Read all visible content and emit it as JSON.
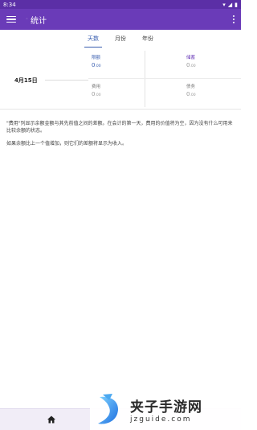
{
  "statusbar": {
    "time": "8:34",
    "battery": "▮",
    "wifi": "▾",
    "signal": "◢"
  },
  "appbar": {
    "title": "统计",
    "title_prefix": "◦"
  },
  "tabs": [
    {
      "label": "天数",
      "active": true
    },
    {
      "label": "月份",
      "active": false
    },
    {
      "label": "年份",
      "active": false
    }
  ],
  "stats": {
    "date": "4月15日",
    "balance": {
      "label": "限额",
      "value": "0",
      "decimals": ".00"
    },
    "savings": {
      "label": "储蓄",
      "value": "0",
      "decimals": ".00"
    },
    "expense": {
      "label": "费用",
      "value": "0",
      "decimals": ".00"
    },
    "debt": {
      "label": "债务",
      "value": "0",
      "decimals": ".00"
    }
  },
  "info": {
    "p1": "\"费用\"列显示余额金额与其先前值之间的差额。在会计的第一天，费用的价值将为空，因为没有什么可用来比较余额的状态。",
    "p2": "如果余额比上一个值增加，则它们的差额将显示为收入。"
  },
  "watermark": {
    "main": "夹子手游网",
    "sub": "jzguide.com"
  },
  "colors": {
    "primary": "#6a3bb8",
    "statusbar": "#5b2fa6",
    "accent": "#3a5fb0"
  }
}
